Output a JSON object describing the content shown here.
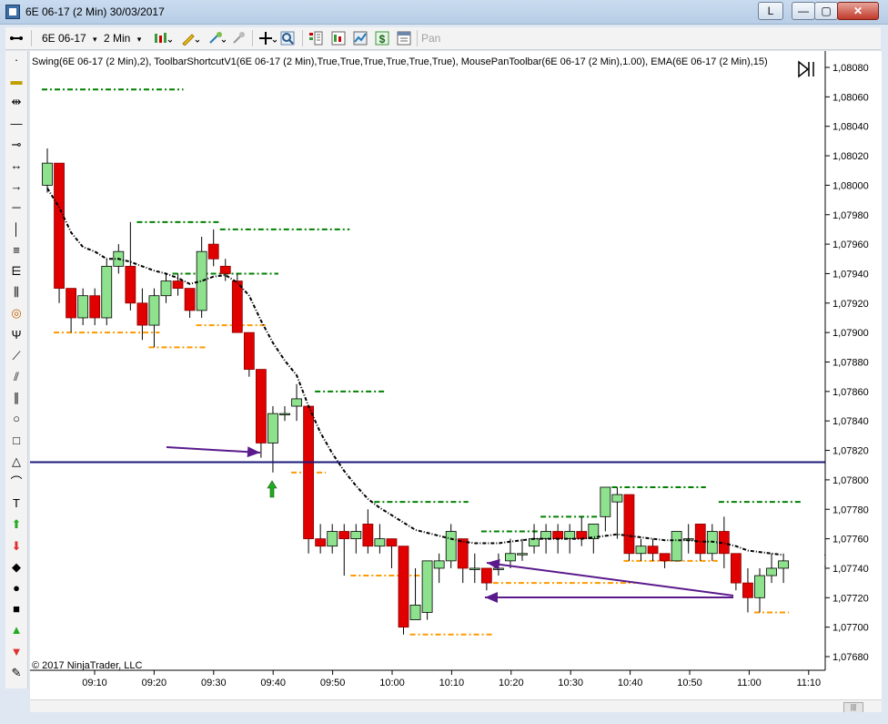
{
  "window": {
    "title": "6E 06-17 (2 Min)  30/03/2017",
    "layout_button": "L",
    "min_label": "—",
    "max_label": "▢",
    "close_label": "✕"
  },
  "toolbar": {
    "instrument": "6E 06-17",
    "instrument_caret": "▾",
    "interval": "2 Min",
    "interval_caret": "▾",
    "pan_label": "Pan",
    "icons": [
      "bars-icon",
      "pencil-icon",
      "crosshair-icon",
      "zoom-icon",
      "strategy-icon",
      "indicator-icon",
      "chart-trader-icon",
      "dollar-icon",
      "properties-icon"
    ]
  },
  "drawing_tools": [
    "select-icon",
    "ruler-icon",
    "risk-reward-icon",
    "line-icon",
    "ray-icon",
    "extended-line-icon",
    "arrow-line-icon",
    "horizontal-line-icon",
    "vertical-line-icon",
    "fib-retracement-icon",
    "fib-extension-icon",
    "fib-timezones-icon",
    "fib-circle-icon",
    "andrews-pitchfork-icon",
    "gann-fan-icon",
    "regression-channel-icon",
    "trend-channel-icon",
    "ellipse-icon",
    "rectangle-icon",
    "triangle-icon",
    "arc-icon",
    "text-icon",
    "arrow-up-icon",
    "arrow-down-icon",
    "diamond-icon",
    "dot-icon",
    "square-icon",
    "triangle-up-icon",
    "triangle-down-icon",
    "region-highlight-icon"
  ],
  "indicator_label": "Swing(6E 06-17 (2 Min),2), ToolbarShortcutV1(6E 06-17 (2 Min),True,True,True,True,True,True), MousePanToolbar(6E 06-17 (2 Min),1.00), EMA(6E 06-17 (2 Min),15)",
  "copyright": "© 2017 NinjaTrader, LLC",
  "price_badges": {
    "last": "1,07749",
    "ema": "1,07745"
  },
  "colors": {
    "up": "#8ee28e",
    "down": "#e00000",
    "ema": "#000000",
    "swing_high": "#008000",
    "swing_low": "#ff9900",
    "hline": "#1a1a7a",
    "arrow": "#5a1a8c",
    "buy_arrow": "#22aa22"
  },
  "chart_data": {
    "type": "candlestick",
    "y_ticks": [
      "1,08080",
      "1,08060",
      "1,08040",
      "1,08020",
      "1,08000",
      "1,07980",
      "1,07960",
      "1,07940",
      "1,07920",
      "1,07900",
      "1,07880",
      "1,07860",
      "1,07840",
      "1,07820",
      "1,07800",
      "1,07780",
      "1,07760",
      "1,07740",
      "1,07720",
      "1,07700",
      "1,07680"
    ],
    "ylim": [
      1.0767,
      1.08085
    ],
    "x_ticks": [
      "09:10",
      "09:20",
      "09:30",
      "09:40",
      "09:50",
      "10:00",
      "10:10",
      "10:20",
      "10:30",
      "10:40",
      "10:50",
      "11:00",
      "11:10"
    ],
    "candles": [
      [
        1.08,
        1.08015,
        1.08025,
        1.07995
      ],
      [
        1.08015,
        1.0793,
        1.08015,
        1.0792
      ],
      [
        1.0793,
        1.0791,
        1.0793,
        1.079
      ],
      [
        1.0791,
        1.07925,
        1.0793,
        1.07905
      ],
      [
        1.07925,
        1.0791,
        1.0793,
        1.07905
      ],
      [
        1.0791,
        1.07945,
        1.0795,
        1.07905
      ],
      [
        1.07945,
        1.07955,
        1.0796,
        1.0794
      ],
      [
        1.07945,
        1.0792,
        1.07975,
        1.07915
      ],
      [
        1.0792,
        1.07905,
        1.0793,
        1.07895
      ],
      [
        1.07905,
        1.07925,
        1.0793,
        1.0789
      ],
      [
        1.07925,
        1.07935,
        1.0794,
        1.0792
      ],
      [
        1.07935,
        1.0793,
        1.0794,
        1.07925
      ],
      [
        1.0793,
        1.07915,
        1.0793,
        1.0791
      ],
      [
        1.07915,
        1.07955,
        1.07965,
        1.0791
      ],
      [
        1.0796,
        1.0795,
        1.0797,
        1.07945
      ],
      [
        1.07945,
        1.0794,
        1.0795,
        1.07935
      ],
      [
        1.07935,
        1.079,
        1.0794,
        1.079
      ],
      [
        1.079,
        1.07875,
        1.079,
        1.0787
      ],
      [
        1.07875,
        1.07825,
        1.07875,
        1.07815
      ],
      [
        1.07825,
        1.07845,
        1.0785,
        1.07805
      ],
      [
        1.07845,
        1.07845,
        1.0785,
        1.0784
      ],
      [
        1.0785,
        1.07855,
        1.07865,
        1.0784
      ],
      [
        1.0785,
        1.0776,
        1.0785,
        1.0775
      ],
      [
        1.0776,
        1.07755,
        1.0777,
        1.0775
      ],
      [
        1.07755,
        1.07765,
        1.0777,
        1.0775
      ],
      [
        1.07765,
        1.0776,
        1.0777,
        1.07735
      ],
      [
        1.0776,
        1.07765,
        1.0777,
        1.0775
      ],
      [
        1.0777,
        1.07755,
        1.0778,
        1.0775
      ],
      [
        1.07755,
        1.0776,
        1.0777,
        1.0775
      ],
      [
        1.0776,
        1.07755,
        1.0776,
        1.0774
      ],
      [
        1.07755,
        1.077,
        1.07755,
        1.07695
      ],
      [
        1.07705,
        1.07715,
        1.0774,
        1.07705
      ],
      [
        1.0771,
        1.07745,
        1.07745,
        1.07705
      ],
      [
        1.0774,
        1.07745,
        1.0775,
        1.0773
      ],
      [
        1.07745,
        1.07765,
        1.0777,
        1.0774
      ],
      [
        1.0776,
        1.0774,
        1.0776,
        1.0773
      ],
      [
        1.0774,
        1.0774,
        1.0775,
        1.0773
      ],
      [
        1.0774,
        1.0773,
        1.0774,
        1.07725
      ],
      [
        1.0774,
        1.0774,
        1.0775,
        1.07735
      ],
      [
        1.07745,
        1.0775,
        1.0776,
        1.0774
      ],
      [
        1.0775,
        1.0775,
        1.0776,
        1.07745
      ],
      [
        1.07755,
        1.0776,
        1.0777,
        1.0775
      ],
      [
        1.0776,
        1.07765,
        1.0777,
        1.0775
      ],
      [
        1.07765,
        1.0776,
        1.0777,
        1.0775
      ],
      [
        1.0776,
        1.07765,
        1.0777,
        1.0775
      ],
      [
        1.07765,
        1.0776,
        1.07775,
        1.07755
      ],
      [
        1.0776,
        1.0777,
        1.0777,
        1.0775
      ],
      [
        1.07775,
        1.07795,
        1.0779,
        1.07765
      ],
      [
        1.07785,
        1.0779,
        1.07795,
        1.0776
      ],
      [
        1.0779,
        1.0775,
        1.0779,
        1.07745
      ],
      [
        1.0775,
        1.07755,
        1.0776,
        1.07745
      ],
      [
        1.07755,
        1.0775,
        1.0776,
        1.07745
      ],
      [
        1.0775,
        1.07745,
        1.0775,
        1.0774
      ],
      [
        1.07745,
        1.07765,
        1.07765,
        1.07745
      ],
      [
        1.0776,
        1.0776,
        1.0777,
        1.0775
      ],
      [
        1.0777,
        1.0775,
        1.0777,
        1.07745
      ],
      [
        1.0775,
        1.07765,
        1.0777,
        1.07745
      ],
      [
        1.07765,
        1.0775,
        1.07775,
        1.0774
      ],
      [
        1.0775,
        1.0773,
        1.0775,
        1.07725
      ],
      [
        1.0773,
        1.0772,
        1.0774,
        1.0771
      ],
      [
        1.0772,
        1.07735,
        1.0774,
        1.0771
      ],
      [
        1.07735,
        1.0774,
        1.0775,
        1.0773
      ],
      [
        1.0774,
        1.07745,
        1.0775,
        1.0773
      ]
    ],
    "ema": [
      1.07998,
      1.07985,
      1.07968,
      1.07958,
      1.07955,
      1.0795,
      1.0795,
      1.07948,
      1.07945,
      1.07942,
      1.0794,
      1.07937,
      1.07933,
      1.07935,
      1.07938,
      1.07939,
      1.07934,
      1.07925,
      1.07908,
      1.07893,
      1.07881,
      1.07871,
      1.0785,
      1.07832,
      1.07818,
      1.07806,
      1.07796,
      1.07787,
      1.07781,
      1.07776,
      1.07771,
      1.07766,
      1.07764,
      1.07762,
      1.0776,
      1.07758,
      1.07757,
      1.07757,
      1.07757,
      1.07758,
      1.07759,
      1.0776,
      1.0776,
      1.0776,
      1.0776,
      1.0776,
      1.07761,
      1.07762,
      1.07763,
      1.07762,
      1.07761,
      1.0776,
      1.07759,
      1.07759,
      1.07759,
      1.07758,
      1.07758,
      1.07757,
      1.07755,
      1.07752,
      1.07751,
      1.0775,
      1.07749
    ],
    "swing_highs": [
      [
        0,
        11,
        1.08065
      ],
      [
        8,
        14,
        1.07975
      ],
      [
        11,
        19,
        1.0794
      ],
      [
        15,
        25,
        1.0797
      ],
      [
        23,
        28,
        1.0786
      ],
      [
        28,
        35,
        1.07785
      ],
      [
        37,
        41,
        1.07765
      ],
      [
        42,
        46,
        1.07775
      ],
      [
        48,
        55,
        1.07795
      ],
      [
        57,
        63,
        1.07785
      ]
    ],
    "swing_lows": [
      [
        1,
        9,
        1.079
      ],
      [
        9,
        13,
        1.0789
      ],
      [
        13,
        18,
        1.07905
      ],
      [
        21,
        23,
        1.07805
      ],
      [
        26,
        31,
        1.07735
      ],
      [
        31,
        37,
        1.07695
      ],
      [
        38,
        49,
        1.0773
      ],
      [
        49,
        56,
        1.07745
      ],
      [
        60,
        62,
        1.0771
      ]
    ],
    "horizontal_line": 1.07812
  }
}
